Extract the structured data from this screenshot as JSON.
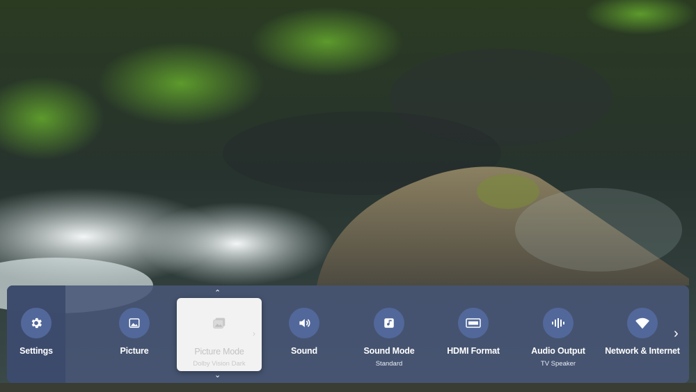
{
  "settings": {
    "label": "Settings",
    "icon": "gear-icon"
  },
  "items": [
    {
      "label": "Picture",
      "icon": "picture-icon"
    },
    {
      "label": "Picture Mode",
      "sublabel": "Dolby Vision Dark",
      "icon": "picture-mode-icon",
      "selected": true
    },
    {
      "label": "Sound",
      "icon": "speaker-icon"
    },
    {
      "label": "Sound Mode",
      "sublabel": "Standard",
      "icon": "music-note-icon"
    },
    {
      "label": "HDMI Format",
      "icon": "hdmi-icon"
    },
    {
      "label": "Audio Output",
      "sublabel": "TV Speaker",
      "icon": "sound-wave-icon"
    },
    {
      "label": "Network & Internet",
      "icon": "wifi-icon"
    }
  ],
  "colors": {
    "panel": "#485678",
    "icon_circle": "#52689a",
    "selected_bg": "#f2f2f2"
  }
}
